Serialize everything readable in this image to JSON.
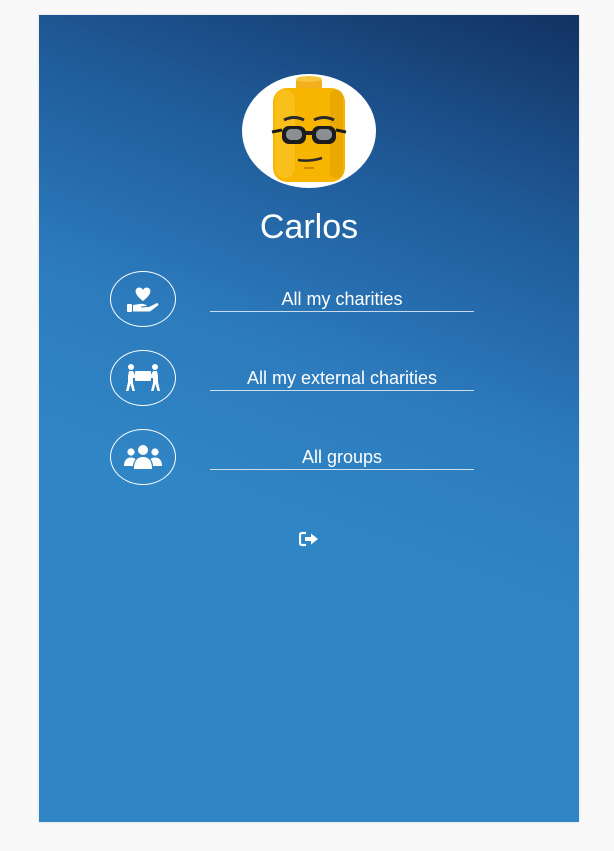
{
  "profile": {
    "name": "Carlos",
    "avatar_icon": "lego-minifig-face-icon"
  },
  "menu": {
    "items": [
      {
        "label": "All my charities",
        "icon": "hand-heart-icon"
      },
      {
        "label": "All my external charities",
        "icon": "people-carrying-box-icon"
      },
      {
        "label": "All groups",
        "icon": "users-group-icon"
      }
    ]
  },
  "logout": {
    "icon": "sign-out-icon"
  },
  "colors": {
    "gradient_dark": "#123262",
    "gradient_light": "#3085c4",
    "text": "#ffffff",
    "page_background": "#f9f9f9"
  }
}
